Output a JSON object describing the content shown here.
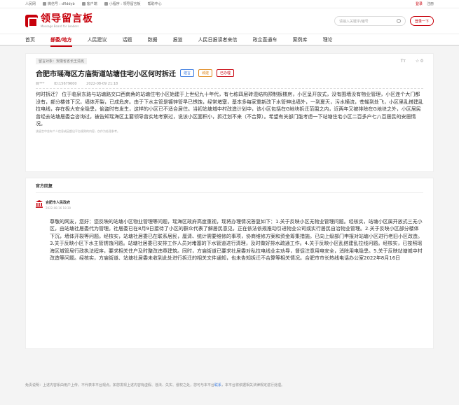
{
  "topbar": {
    "site": "人民网",
    "wechat": "微信号 : dflddyb",
    "client": "客户端",
    "miniapp": "小程序 : 领导留言板",
    "help": "帮助中心",
    "login": "登录",
    "register": "注册"
  },
  "header": {
    "logo_cn": "领导留言板",
    "logo_en": "Message Board for Leaders",
    "search_placeholder": "请输入关键字/编号",
    "login_button": "登录一下"
  },
  "nav": {
    "items": [
      "首页",
      "部委/地方",
      "人民建议",
      "话题",
      "数据",
      "报道",
      "人民日报读者来信",
      "政企直通车",
      "案例库",
      "理论"
    ]
  },
  "message": {
    "object_tag": "留言对象：安徽省省长王清宪",
    "font_tool": "Tт",
    "like_count": "☆ 0",
    "title": "合肥市瑶海区方庙街道站塘住宅小区何时拆迁",
    "badges": [
      "建言",
      "城建",
      "已办理"
    ],
    "author": "目***",
    "id": "ID:15679600",
    "time": "2022-08-09 21:18",
    "content": "何时拆迁？ 位于临泉东路与站塘路交口西南角的站塘住宅小区始建于上世纪九十年代，有七栋四层砖混结构预制板楼房，小区呈开放式，没有围墙没有物业管理，小区连个大门都没有，部分楼体下沉，墙体开裂，已成危房。由于下水主管是镀锌管早已锈蚀，经常堵塞，基本多每家重新改下水管伸出墙外，一到夏天，污水横流，苍蝇到处飞，小区里乱搭建乱拉电线，存在极大安全隐患，偷盗时有发生，这样的小区已不适合居住。当初站塘城中村改造计划中，该小区包括在G地块拆迁范围之内，近两年又被排除在G地块之外，小区居民曾经去站塘居委会咨询过，被告知瑶海区主要领导曾实地考察过，说该小区面积小，拆迁划不来（不合算）。希望有关部门能考虑一下站塘住宅小区二百多户七八百居民的安居情况。",
    "note": "该留言中含有个人信息或因超出平台规则的内容，仅作为处理参考。"
  },
  "reply_section": {
    "title": "官方回复",
    "dept": "合肥市人民政府",
    "time": "2022-08-16 18:30",
    "body": "尊敬的网友，您好：您反映的站塘小区物业管理等问题，瑶海区政府高度重视，现将办理情况答复如下：1.关于反映小区无物业管理问题。经核实，站塘小区属开放式三无小区，由站塘社居委代为管理。社居委已在8月9日接待了小区的群众代表了解居民意见，正在依法依规推动引进物业公司或实行居民自治物业管理。2.关于反映小区部分楼体下沉，墙体开裂等问题。经核实，站塘社居委已在联系居民，厘清、统计需要维修的事项，协商维修方案和资金筹集措施。已向上级部门申报对站塘小区进行老旧小区改造。3.关于反映小区下水主管锈蚀问题。站塘社居委已安排工作人员对堵塞的下水管道进行清理，及时做好排水疏通工作。4.关于反映小区乱搭建乱拉线问题。经核实，已按照瑶海区城管局行政执法程序，要求相关住户及时整改违章建筑。同时，方庙街道已要求社居委对私拉电线业主劝导，督促注意用电安全，消除用电隐患。5.关于反映站塘城中村改造等问题。经核实，方庙街道、站塘社居委未收到此处进行拆迁的相关文件通知，也未告知拆迁不合算等相关情况。合肥市市长热线电话办公室2022年8月16日"
  },
  "footer": {
    "text": "免责说明：上述内容系由用户上传，不代表本平台观点。如您发现上述内容有虚假、违法、失实、侵权之处，您可与本平台",
    "link": "联系",
    "tail": "，本平台将依据相关法律规定进行处理。"
  },
  "colors": {
    "brand": "#c7000b",
    "link": "#3b7be0"
  }
}
